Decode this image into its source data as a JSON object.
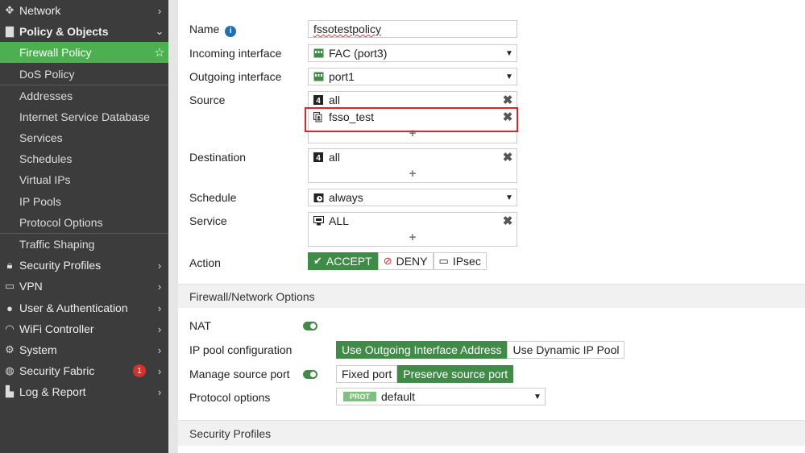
{
  "sidebar": {
    "network": "Network",
    "policy_objects": "Policy & Objects",
    "firewall_policy": "Firewall Policy",
    "dos_policy": "DoS Policy",
    "addresses": "Addresses",
    "isdb": "Internet Service Database",
    "services": "Services",
    "schedules": "Schedules",
    "virtual_ips": "Virtual IPs",
    "ip_pools": "IP Pools",
    "protocol_options": "Protocol Options",
    "traffic_shaping": "Traffic Shaping",
    "security_profiles": "Security Profiles",
    "vpn": "VPN",
    "user_auth": "User & Authentication",
    "wifi_controller": "WiFi Controller",
    "system": "System",
    "security_fabric": "Security Fabric",
    "security_fabric_badge": "1",
    "log_report": "Log & Report"
  },
  "form": {
    "name_label": "Name",
    "name_value": "fssotestpolicy",
    "incoming_label": "Incoming interface",
    "incoming_value": "FAC (port3)",
    "outgoing_label": "Outgoing interface",
    "outgoing_value": "port1",
    "source_label": "Source",
    "source_items": [
      "all",
      "fsso_test"
    ],
    "destination_label": "Destination",
    "destination_items": [
      "all"
    ],
    "schedule_label": "Schedule",
    "schedule_value": "always",
    "service_label": "Service",
    "service_items": [
      "ALL"
    ],
    "action_label": "Action",
    "actions": [
      "ACCEPT",
      "DENY",
      "IPsec"
    ],
    "plus": "+"
  },
  "fw_options": {
    "section_title": "Firewall/Network Options",
    "nat_label": "NAT",
    "ip_pool_label": "IP pool configuration",
    "ip_pool_options": [
      "Use Outgoing Interface Address",
      "Use Dynamic IP Pool"
    ],
    "manage_port_label": "Manage source port",
    "port_options": [
      "Fixed port",
      "Preserve source port"
    ],
    "protocol_label": "Protocol options",
    "protocol_tag": "PROT",
    "protocol_value": "default"
  },
  "security_section": {
    "title": "Security Profiles"
  },
  "colors": {
    "sidebar_bg": "#3c3c3c",
    "accent_green": "#4caf50",
    "button_green": "#3f8b47",
    "highlight_red": "#d9262c"
  }
}
